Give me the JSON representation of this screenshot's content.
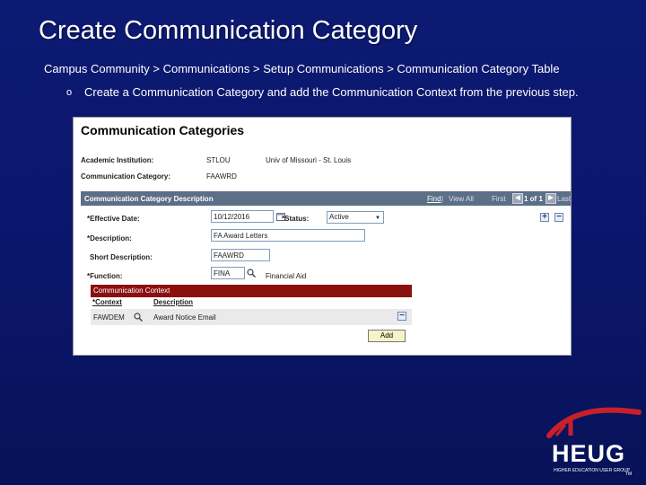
{
  "slide": {
    "title": "Create Communication Category",
    "nav_path": "Campus Community > Communications > Setup Communications > Communication Category Table",
    "bullet_glyph": "o",
    "bullet_text": "Create a Communication Category and add the Communication Context from the previous step."
  },
  "screen": {
    "page_title": "Communication Categories",
    "academic_institution_label": "Academic Institution:",
    "academic_institution_value": "STLOU",
    "academic_institution_desc": "Univ of Missouri - St. Louis",
    "communication_category_label": "Communication Category:",
    "communication_category_value": "FAAWRD",
    "desc_section": {
      "title": "Communication Category Description",
      "find": "Find",
      "separator": "|",
      "view_all": "View All",
      "first": "First",
      "prev_glyph": "◀",
      "count": "1 of 1",
      "next_glyph": "▶",
      "last": "Last"
    },
    "fields": {
      "effective_date_label": "*Effective Date:",
      "effective_date_value": "10/12/2016",
      "status_label": "*Status:",
      "status_value": "Active",
      "description_label": "*Description:",
      "description_value": "FA Award Letters",
      "short_description_label": "Short Description:",
      "short_description_value": "FAAWRD",
      "function_label": "*Function:",
      "function_value": "FINA",
      "function_desc": "Financial Aid",
      "plus_glyph": "+",
      "minus_glyph": "−"
    },
    "context_section": {
      "title": "Communication Context",
      "col_context": "*Context",
      "col_description": "Description",
      "row_context": "FAWDEM",
      "row_description": "Award Notice Email",
      "add_button": "Add"
    }
  },
  "logo": {
    "text": "HEUG",
    "subtitle": "HIGHER EDUCATION USER GROUP",
    "tm": "TM",
    "roof_color": "#c8202a"
  }
}
